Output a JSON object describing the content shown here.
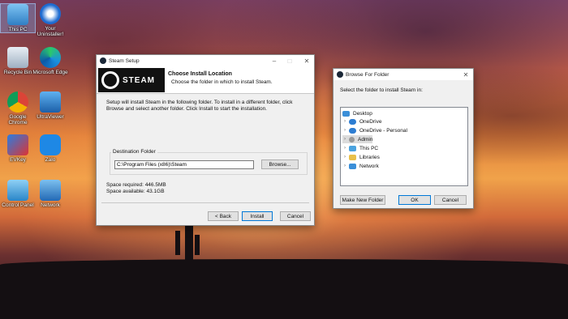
{
  "desktop": {
    "icons": [
      {
        "label": "This PC"
      },
      {
        "label": "Your Uninstaller!"
      },
      {
        "label": "Recycle Bin"
      },
      {
        "label": "Microsoft Edge"
      },
      {
        "label": "Google Chrome"
      },
      {
        "label": "UltraViewer"
      },
      {
        "label": "EVKey"
      },
      {
        "label": "Zalo"
      },
      {
        "label": "Control Panel"
      },
      {
        "label": "Network"
      }
    ]
  },
  "steam_setup": {
    "title": "Steam Setup",
    "logo_text": "STEAM",
    "heading": "Choose Install Location",
    "subheading": "Choose the folder in which to install Steam.",
    "description": "Setup will install Steam in the following folder. To install in a different folder, click Browse and select another folder. Click Install to start the installation.",
    "group_label": "Destination Folder",
    "folder_value": "C:\\Program Files (x86)\\Steam",
    "browse_label": "Browse...",
    "space_required": "Space required: 446.5MB",
    "space_available": "Space available: 43.1GB",
    "back_label": "< Back",
    "install_label": "Install",
    "cancel_label": "Cancel"
  },
  "browse_folder": {
    "title": "Browse For Folder",
    "instruction": "Select the folder to install Steam in:",
    "tree": [
      {
        "label": "Desktop",
        "color": "#3b8fd8"
      },
      {
        "label": "OneDrive",
        "color": "#2d7dd2"
      },
      {
        "label": "OneDrive - Personal",
        "color": "#2d7dd2"
      },
      {
        "label": "Admin",
        "color": "#9a9a9a"
      },
      {
        "label": "This PC",
        "color": "#4aa3df"
      },
      {
        "label": "Libraries",
        "color": "#e8c04a"
      },
      {
        "label": "Network",
        "color": "#3b8fd8"
      }
    ],
    "new_folder_label": "Make New Folder",
    "ok_label": "OK",
    "cancel_label": "Cancel"
  }
}
